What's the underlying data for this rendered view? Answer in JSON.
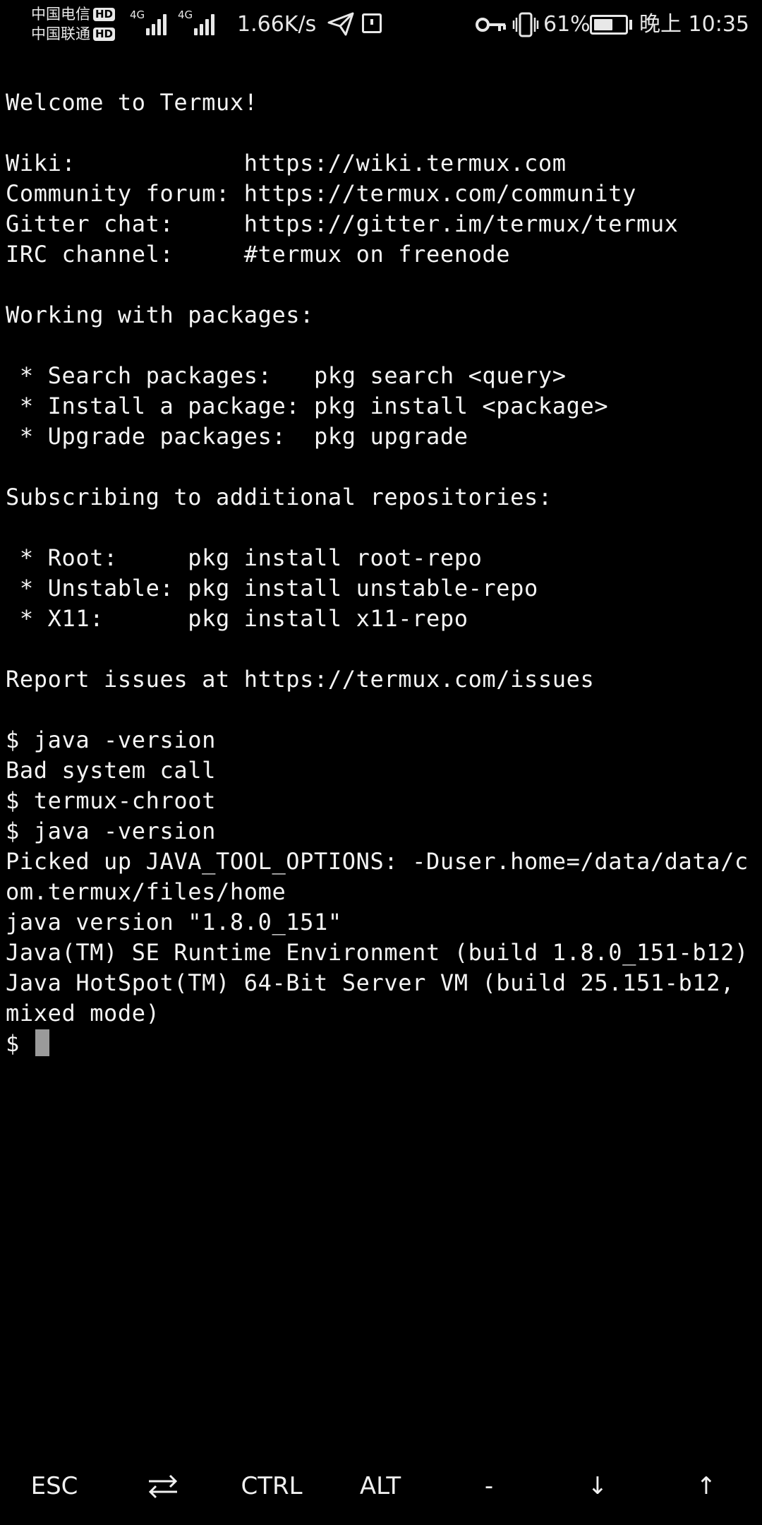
{
  "status_bar": {
    "carriers": [
      {
        "name": "中国电信",
        "badge": "HD"
      },
      {
        "name": "中国联通",
        "badge": "HD"
      }
    ],
    "signals": [
      {
        "tag": "4G",
        "bars": 4
      },
      {
        "tag": "4G",
        "bars": 4
      }
    ],
    "net_speed": "1.66K/s",
    "battery_percent": "61%",
    "battery_level": 0.61,
    "time": "晚上 10:35",
    "icons": [
      "send-icon",
      "notification-icon",
      "key-icon",
      "vibrate-icon",
      "battery-charging-icon"
    ]
  },
  "terminal": {
    "lines": [
      "Welcome to Termux!",
      "",
      "Wiki:            https://wiki.termux.com",
      "Community forum: https://termux.com/community",
      "Gitter chat:     https://gitter.im/termux/termux",
      "IRC channel:     #termux on freenode",
      "",
      "Working with packages:",
      "",
      " * Search packages:   pkg search <query>",
      " * Install a package: pkg install <package>",
      " * Upgrade packages:  pkg upgrade",
      "",
      "Subscribing to additional repositories:",
      "",
      " * Root:     pkg install root-repo",
      " * Unstable: pkg install unstable-repo",
      " * X11:      pkg install x11-repo",
      "",
      "Report issues at https://termux.com/issues",
      "",
      "$ java -version",
      "Bad system call",
      "$ termux-chroot",
      "$ java -version",
      "Picked up JAVA_TOOL_OPTIONS: -Duser.home=/data/data/c",
      "om.termux/files/home",
      "java version \"1.8.0_151\"",
      "Java(TM) SE Runtime Environment (build 1.8.0_151-b12)",
      "Java HotSpot(TM) 64-Bit Server VM (build 25.151-b12,",
      "mixed mode)"
    ],
    "prompt": "$ "
  },
  "extra_keys": [
    {
      "label": "ESC",
      "icon": null
    },
    {
      "label": "",
      "icon": "tab-arrows-icon"
    },
    {
      "label": "CTRL",
      "icon": null
    },
    {
      "label": "ALT",
      "icon": null
    },
    {
      "label": "-",
      "icon": null
    },
    {
      "label": "↓",
      "icon": null
    },
    {
      "label": "↑",
      "icon": null
    }
  ]
}
